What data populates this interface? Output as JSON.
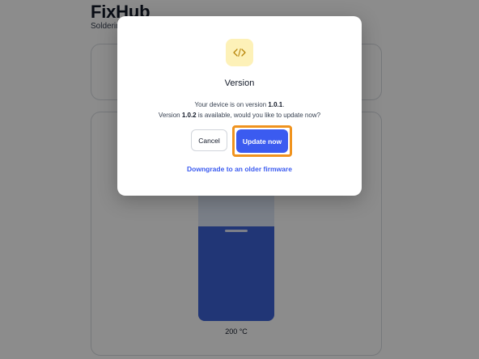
{
  "header": {
    "app_title": "FixHub",
    "subtitle": "Soldering"
  },
  "temperature": {
    "label": "200 °C",
    "fill_fraction": 0.66
  },
  "modal": {
    "icon": "code-icon",
    "title": "Version",
    "line1_prefix": "Your device is on version ",
    "current_version": "1.0.1",
    "line1_suffix": ".",
    "line2_prefix": "Version ",
    "new_version": "1.0.2",
    "line2_suffix": " is available, would you like to update now?",
    "cancel_label": "Cancel",
    "update_label": "Update now",
    "downgrade_label": "Downgrade to an older firmware"
  },
  "colors": {
    "accent": "#3b5bf0",
    "highlight": "#f0931e",
    "icon_bg": "#fdf1b8",
    "icon_fg": "#b8860b"
  }
}
